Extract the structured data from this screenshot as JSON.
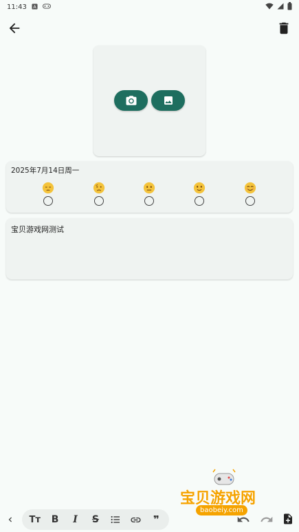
{
  "status_bar": {
    "time": "11:43",
    "icons_left": [
      "a-notification-icon",
      "game-notification-icon"
    ],
    "icons_right": [
      "wifi-icon",
      "signal-icon",
      "battery-icon"
    ]
  },
  "app_bar": {
    "back_icon": "arrow-left-icon",
    "delete_icon": "trash-icon"
  },
  "photo_section": {
    "camera_icon": "camera-icon",
    "gallery_icon": "image-icon"
  },
  "mood_section": {
    "date": "2025年7月14日周一",
    "options": [
      {
        "icon": "pensive-face-icon",
        "selected": false
      },
      {
        "icon": "worried-face-icon",
        "selected": false
      },
      {
        "icon": "neutral-face-icon",
        "selected": false
      },
      {
        "icon": "slight-smile-face-icon",
        "selected": false
      },
      {
        "icon": "smiling-face-icon",
        "selected": false
      }
    ]
  },
  "note": {
    "text": "宝贝游戏网测试"
  },
  "toolbar": {
    "collapse_icon": "chevron-left-icon",
    "format_buttons": [
      {
        "icon": "text-size-icon",
        "glyph": "Tт"
      },
      {
        "icon": "bold-icon",
        "glyph": "B"
      },
      {
        "icon": "italic-icon",
        "glyph": "I"
      },
      {
        "icon": "strikethrough-icon",
        "glyph": "S"
      },
      {
        "icon": "bullet-list-icon",
        "glyph": ""
      },
      {
        "icon": "link-icon",
        "glyph": ""
      },
      {
        "icon": "quote-icon",
        "glyph": "❞"
      }
    ],
    "undo_icon": "undo-icon",
    "redo_icon": "redo-icon",
    "new_note_icon": "note-add-icon"
  },
  "watermark": {
    "title": "宝贝游戏网",
    "url": "baobeiy.com"
  },
  "colors": {
    "background": "#f7fbf9",
    "card": "#eff3f1",
    "accent": "#1e6e5f",
    "emoji": "#f4c33b",
    "watermark": "#f5a300"
  }
}
